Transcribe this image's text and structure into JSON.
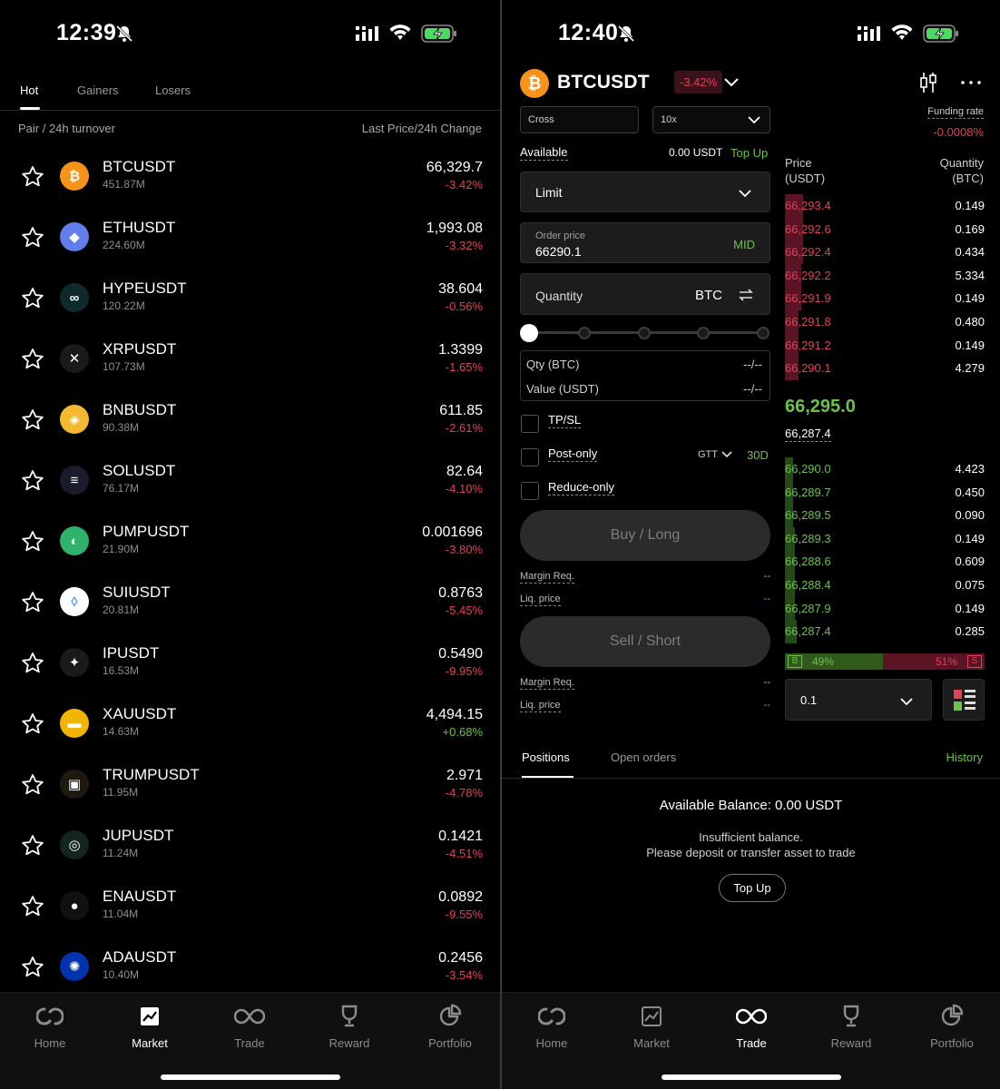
{
  "status_left": {
    "time": "12:39"
  },
  "status_right": {
    "time": "12:40"
  },
  "market": {
    "tabs": [
      "Hot",
      "Gainers",
      "Losers"
    ],
    "col_left": "Pair / 24h turnover",
    "col_right": "Last Price/24h Change",
    "rows": [
      {
        "symbol": "BTCUSDT",
        "volume": "451.87M",
        "price": "66,329.7",
        "change": "-3.42%",
        "icon": "bitcoin-icon",
        "color": "#f7931a"
      },
      {
        "symbol": "ETHUSDT",
        "volume": "224.60M",
        "price": "1,993.08",
        "change": "-3.32%",
        "icon": "ethereum-icon",
        "color": "#627eea"
      },
      {
        "symbol": "HYPEUSDT",
        "volume": "120.22M",
        "price": "38.604",
        "change": "-0.56%",
        "icon": "hype-icon",
        "color": "#0f2a2a"
      },
      {
        "symbol": "XRPUSDT",
        "volume": "107.73M",
        "price": "1.3399",
        "change": "-1.65%",
        "icon": "xrp-icon",
        "color": "#1a1a1a"
      },
      {
        "symbol": "BNBUSDT",
        "volume": "90.38M",
        "price": "611.85",
        "change": "-2.61%",
        "icon": "bnb-icon",
        "color": "#f3ba2f"
      },
      {
        "symbol": "SOLUSDT",
        "volume": "76.17M",
        "price": "82.64",
        "change": "-4.10%",
        "icon": "solana-icon",
        "color": "#1b1b2e"
      },
      {
        "symbol": "PUMPUSDT",
        "volume": "21.90M",
        "price": "0.001696",
        "change": "-3.80%",
        "icon": "pump-icon",
        "color": "#2fb36b"
      },
      {
        "symbol": "SUIUSDT",
        "volume": "20.81M",
        "price": "0.8763",
        "change": "-5.45%",
        "icon": "sui-icon",
        "color": "#ffffff"
      },
      {
        "symbol": "IPUSDT",
        "volume": "16.53M",
        "price": "0.5490",
        "change": "-9.95%",
        "icon": "ip-icon",
        "color": "#1a1a1a"
      },
      {
        "symbol": "XAUUSDT",
        "volume": "14.63M",
        "price": "4,494.15",
        "change": "+0.68%",
        "icon": "gold-icon",
        "color": "#f1b400"
      },
      {
        "symbol": "TRUMPUSDT",
        "volume": "11.95M",
        "price": "2.971",
        "change": "-4.78%",
        "icon": "trump-icon",
        "color": "#1e1a10"
      },
      {
        "symbol": "JUPUSDT",
        "volume": "11.24M",
        "price": "0.1421",
        "change": "-4.51%",
        "icon": "jupiter-icon",
        "color": "#14241f"
      },
      {
        "symbol": "ENAUSDT",
        "volume": "11.04M",
        "price": "0.0892",
        "change": "-9.55%",
        "icon": "ena-icon",
        "color": "#111111"
      },
      {
        "symbol": "ADAUSDT",
        "volume": "10.40M",
        "price": "0.2456",
        "change": "-3.54%",
        "icon": "cardano-icon",
        "color": "#0033ad"
      }
    ]
  },
  "nav": {
    "home": "Home",
    "market": "Market",
    "trade": "Trade",
    "reward": "Reward",
    "portfolio": "Portfolio"
  },
  "trade": {
    "pair": "BTCUSDT",
    "pair_change": "-3.42%",
    "margin_mode": "Cross",
    "leverage": "10x",
    "funding_label": "Funding rate",
    "funding_value": "-0.0008%",
    "available_label": "Available",
    "available_value": "0.00 USDT",
    "top_up_link": "Top Up",
    "order_type": "Limit",
    "order_price_label": "Order price",
    "order_price_value": "66290.1",
    "mid_label": "MID",
    "quantity_placeholder": "Quantity",
    "quantity_unit": "BTC",
    "qty_label": "Qty (BTC)",
    "qty_value": "--/--",
    "value_label": "Value (USDT)",
    "value_value": "--/--",
    "tpsl_label": "TP/SL",
    "post_only_label": "Post-only",
    "gtt_label": "GTT",
    "gtt_value": "30D",
    "reduce_only_label": "Reduce-only",
    "buy_label": "Buy / Long",
    "sell_label": "Sell / Short",
    "margin_req_label": "Margin Req.",
    "liq_price_label": "Liq. price",
    "dash": "--",
    "ob_price_header": "Price\n(USDT)",
    "ob_qty_header": "Quantity\n(BTC)",
    "asks": [
      {
        "price": "66,293.4",
        "qty": "0.149",
        "depth": 0.09
      },
      {
        "price": "66,292.6",
        "qty": "0.169",
        "depth": 0.09
      },
      {
        "price": "66,292.4",
        "qty": "0.434",
        "depth": 0.09
      },
      {
        "price": "66,292.2",
        "qty": "5.334",
        "depth": 0.08
      },
      {
        "price": "66,291.9",
        "qty": "0.149",
        "depth": 0.08
      },
      {
        "price": "66,291.8",
        "qty": "0.480",
        "depth": 0.07
      },
      {
        "price": "66,291.2",
        "qty": "0.149",
        "depth": 0.07
      },
      {
        "price": "66,290.1",
        "qty": "4.279",
        "depth": 0.07
      }
    ],
    "mark_price": "66,295.0",
    "index_price": "66,287.4",
    "bids": [
      {
        "price": "66,290.0",
        "qty": "4.423",
        "depth": 0.04
      },
      {
        "price": "66,289.7",
        "qty": "0.450",
        "depth": 0.04
      },
      {
        "price": "66,289.5",
        "qty": "0.090",
        "depth": 0.04
      },
      {
        "price": "66,289.3",
        "qty": "0.149",
        "depth": 0.05
      },
      {
        "price": "66,288.6",
        "qty": "0.609",
        "depth": 0.05
      },
      {
        "price": "66,288.4",
        "qty": "0.075",
        "depth": 0.05
      },
      {
        "price": "66,287.9",
        "qty": "0.149",
        "depth": 0.05
      },
      {
        "price": "66,287.4",
        "qty": "0.285",
        "depth": 0.06
      }
    ],
    "buy_ratio_label": "B",
    "buy_ratio": "49%",
    "sell_ratio": "51%",
    "sell_ratio_label": "S",
    "buy_ratio_value": 0.49,
    "precision": "0.1",
    "tabs": [
      "Positions",
      "Open orders"
    ],
    "history_label": "History",
    "available_balance": "Available Balance: 0.00 USDT",
    "insufficient": "Insufficient balance.",
    "deposit_hint": "Please deposit or transfer asset to trade",
    "top_up_button": "Top Up"
  },
  "colors": {
    "negative": "#e0425a",
    "positive": "#6cc24a",
    "ask_bar": "#5a1424",
    "bid_bar": "#234a17"
  }
}
